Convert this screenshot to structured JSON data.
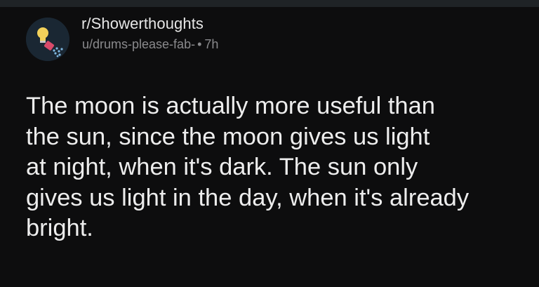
{
  "post": {
    "subreddit": "r/Showerthoughts",
    "author": "u/drums-please-fab-",
    "separator": "•",
    "age": "7h",
    "avatar_icon": "shower-head-lightbulb-icon",
    "body_lines": [
      "The moon is actually more useful than",
      "the sun, since the moon gives us light",
      "at night, when it's dark. The sun only",
      "gives us light in the day, when it's already",
      "bright."
    ]
  },
  "colors": {
    "background": "#0d0d0e",
    "text": "#ededed",
    "meta_text": "#8a8a8d",
    "avatar_bg": "#1a2733"
  }
}
